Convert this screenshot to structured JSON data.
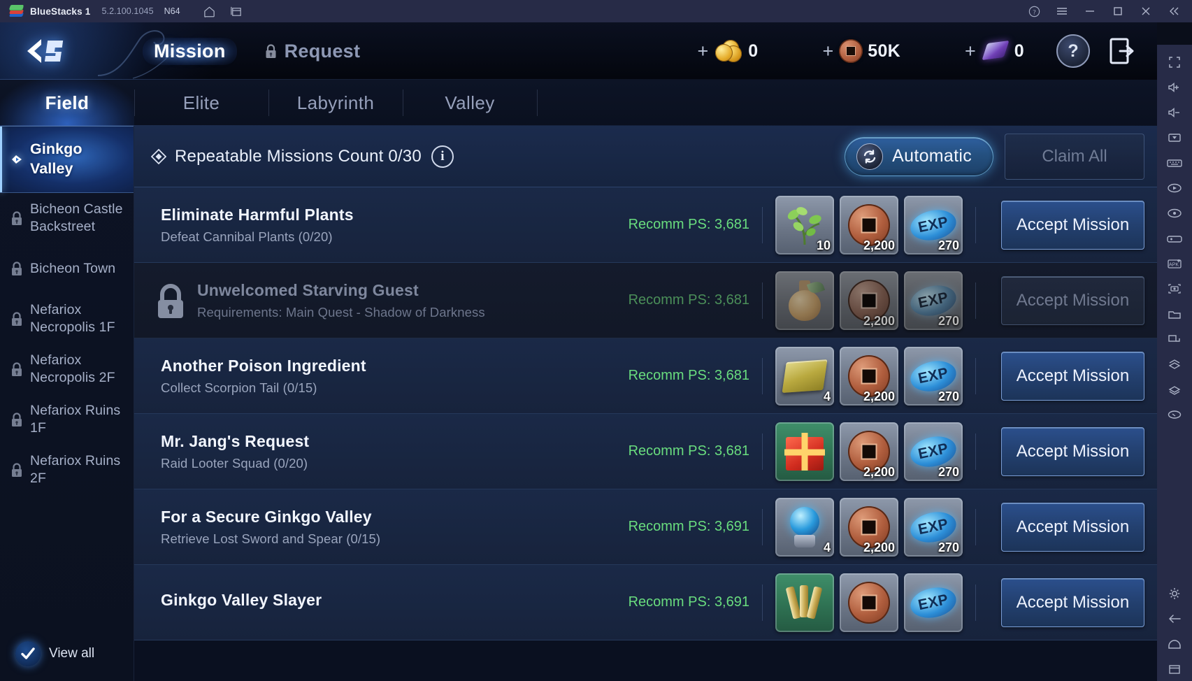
{
  "titlebar": {
    "app_name": "BlueStacks 1",
    "version": "5.2.100.1045",
    "arch": "N64",
    "icons": [
      "home-icon",
      "multi-instance-icon"
    ],
    "controls": [
      "help-icon",
      "menu-icon",
      "minimize-icon",
      "maximize-icon",
      "close-icon",
      "collapse-icon"
    ]
  },
  "game_header": {
    "nav": [
      {
        "label": "Mission",
        "active": true,
        "locked": false
      },
      {
        "label": "Request",
        "active": false,
        "locked": true
      }
    ],
    "currencies": [
      {
        "icon": "gold-coins-icon",
        "value": "0",
        "plus": "+"
      },
      {
        "icon": "copper-coin-icon",
        "value": "50K",
        "plus": "+"
      },
      {
        "icon": "purple-crystal-icon",
        "value": "0",
        "plus": "+"
      }
    ],
    "help_label": "?",
    "exit_icon": "exit-door-icon"
  },
  "tabs": [
    {
      "label": "Field",
      "active": true
    },
    {
      "label": "Elite",
      "active": false
    },
    {
      "label": "Labyrinth",
      "active": false
    },
    {
      "label": "Valley",
      "active": false
    }
  ],
  "sidebar": {
    "items": [
      {
        "label": "Ginkgo Valley",
        "locked": false,
        "active": true
      },
      {
        "label": "Bicheon Castle Backstreet",
        "locked": true,
        "active": false
      },
      {
        "label": "Bicheon Town",
        "locked": true,
        "active": false
      },
      {
        "label": "Nefariox Necropolis 1F",
        "locked": true,
        "active": false
      },
      {
        "label": "Nefariox Necropolis 2F",
        "locked": true,
        "active": false
      },
      {
        "label": "Nefariox Ruins 1F",
        "locked": true,
        "active": false
      },
      {
        "label": "Nefariox Ruins 2F",
        "locked": true,
        "active": false
      }
    ],
    "view_all_label": "View all"
  },
  "panel": {
    "header": {
      "title": "Repeatable Missions Count 0/30",
      "info_label": "i",
      "automatic_label": "Automatic",
      "claim_all_label": "Claim All"
    },
    "missions": [
      {
        "title": "Eliminate Harmful Plants",
        "subtitle": "Defeat Cannibal Plants (0/20)",
        "recomm": "Recomm PS: 3,681",
        "locked": false,
        "rewards": [
          {
            "icon": "plant-sprout-icon",
            "qty": "10"
          },
          {
            "icon": "copper-coin-icon",
            "qty": "2,200"
          },
          {
            "icon": "exp-orb-icon",
            "qty": "270"
          }
        ],
        "action": "Accept Mission"
      },
      {
        "title": "Unwelcomed Starving Guest",
        "subtitle": "Requirements: Main Quest - Shadow of Darkness",
        "recomm": "Recomm PS: 3,681",
        "locked": true,
        "rewards": [
          {
            "icon": "potion-bottle-icon",
            "qty": ""
          },
          {
            "icon": "copper-coin-icon",
            "qty": "2,200"
          },
          {
            "icon": "exp-orb-icon",
            "qty": "270"
          }
        ],
        "action": "Accept Mission"
      },
      {
        "title": "Another Poison Ingredient",
        "subtitle": "Collect Scorpion Tail (0/15)",
        "recomm": "Recomm PS: 3,681",
        "locked": false,
        "rewards": [
          {
            "icon": "gold-ingot-icon",
            "qty": "4"
          },
          {
            "icon": "copper-coin-icon",
            "qty": "2,200"
          },
          {
            "icon": "exp-orb-icon",
            "qty": "270"
          }
        ],
        "action": "Accept Mission"
      },
      {
        "title": "Mr. Jang's Request",
        "subtitle": "Raid Looter Squad (0/20)",
        "recomm": "Recomm PS: 3,681",
        "locked": false,
        "rewards": [
          {
            "icon": "gift-box-icon",
            "qty": ""
          },
          {
            "icon": "copper-coin-icon",
            "qty": "2,200"
          },
          {
            "icon": "exp-orb-icon",
            "qty": "270"
          }
        ],
        "action": "Accept Mission"
      },
      {
        "title": "For a Secure Ginkgo Valley",
        "subtitle": "Retrieve Lost Sword and Spear (0/15)",
        "recomm": "Recomm PS: 3,691",
        "locked": false,
        "rewards": [
          {
            "icon": "blue-orb-icon",
            "qty": "4"
          },
          {
            "icon": "copper-coin-icon",
            "qty": "2,200"
          },
          {
            "icon": "exp-orb-icon",
            "qty": "270"
          }
        ],
        "action": "Accept Mission"
      },
      {
        "title": "Ginkgo Valley Slayer",
        "subtitle": "",
        "recomm": "Recomm PS: 3,691",
        "locked": false,
        "rewards": [
          {
            "icon": "scroll-bundle-icon",
            "qty": ""
          },
          {
            "icon": "copper-coin-icon",
            "qty": ""
          },
          {
            "icon": "exp-orb-icon",
            "qty": ""
          }
        ],
        "action": "Accept Mission"
      }
    ]
  },
  "rail": {
    "icons": [
      "fullscreen-icon",
      "volume-up-icon",
      "volume-down-icon",
      "pointer-icon",
      "keyboard-icon",
      "record-macro-icon",
      "rewind-icon",
      "gamepad-icon",
      "install-apk-icon",
      "screenshot-icon",
      "folder-icon",
      "resize-icon",
      "multi-layer-icon",
      "stack-icon",
      "eye-icon"
    ],
    "bottom_icons": [
      "gear-icon",
      "back-arrow-icon",
      "home-icon",
      "recents-icon"
    ]
  }
}
